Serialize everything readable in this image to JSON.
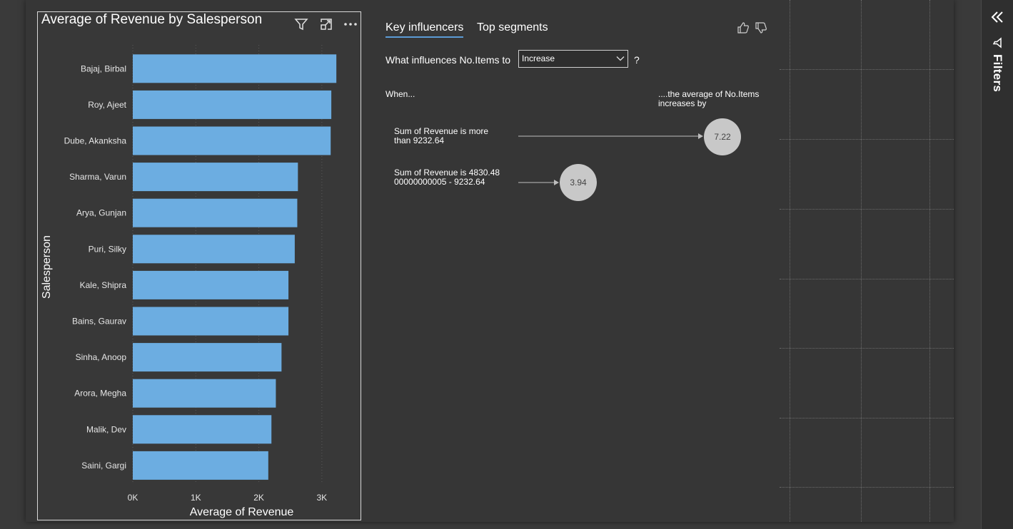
{
  "chart_visual": {
    "title": "Average of Revenue by Salesperson",
    "icons": [
      "filter-icon",
      "focus-mode-icon",
      "more-options-icon"
    ]
  },
  "chart_data": {
    "type": "bar",
    "orientation": "horizontal",
    "title": "Average of Revenue by Salesperson",
    "xlabel": "Average of Revenue",
    "ylabel": "Salesperson",
    "categories": [
      "Bajaj, Birbal",
      "Roy, Ajeet",
      "Dube, Akanksha",
      "Sharma, Varun",
      "Arya, Gunjan",
      "Puri, Silky",
      "Kale, Shipra",
      "Bains, Gaurav",
      "Sinha, Anoop",
      "Arora, Megha",
      "Malik, Dev",
      "Saini, Gargi"
    ],
    "values": [
      3230,
      3150,
      3140,
      2620,
      2610,
      2570,
      2470,
      2470,
      2360,
      2270,
      2200,
      2150
    ],
    "xticks": [
      "0K",
      "1K",
      "2K",
      "3K"
    ],
    "xlim": [
      0,
      3500
    ],
    "bar_color": "#6cade1",
    "grid": true
  },
  "key_influencers": {
    "tabs": [
      "Key influencers",
      "Top segments"
    ],
    "active_tab": "Key influencers",
    "question_prefix": "What influences No.Items to",
    "selected_direction": "Increase",
    "question_suffix": "?",
    "when_label": "When...",
    "result_header": "....the average of No.Items increases by",
    "influencers": [
      {
        "condition": "Sum of Revenue is more than 9232.64",
        "value": "7.22"
      },
      {
        "condition": "Sum of Revenue is 4830.4800000000005 - 9232.64",
        "value": "3.94"
      }
    ],
    "icons": [
      "thumbs-up-icon",
      "thumbs-down-icon"
    ]
  },
  "filters_pane": {
    "label": "Filters",
    "icons": [
      "collapse-double-chevron-icon",
      "filter-icon"
    ]
  },
  "colors": {
    "page_background": "#3a3a3a",
    "canvas": "#363636",
    "bar": "#6cade1",
    "tab_underline": "#5b9bd5",
    "bubble": "#c8c8c8"
  }
}
